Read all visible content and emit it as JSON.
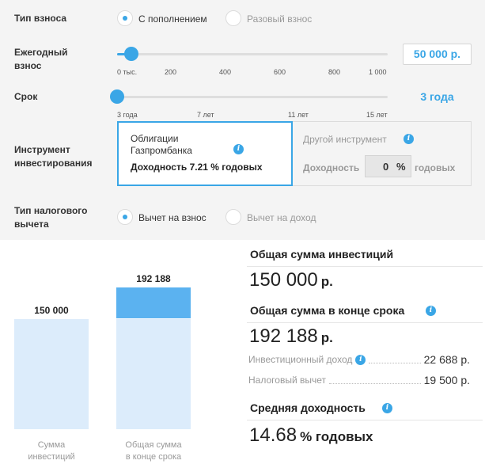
{
  "form": {
    "contribution_type": {
      "label": "Тип взноса",
      "options": [
        "С пополнением",
        "Разовый взнос"
      ],
      "selected": 0
    },
    "annual_contribution": {
      "label_line1": "Ежегодный",
      "label_line2": "взнос",
      "value": "50 000 р.",
      "ticks": [
        "0 тыс.",
        "200",
        "400",
        "600",
        "800",
        "1 000"
      ]
    },
    "term": {
      "label": "Срок",
      "value": "3 года",
      "ticks": [
        "3 года",
        "7 лет",
        "11 лет",
        "15 лет"
      ]
    },
    "instrument": {
      "label_line1": "Инструмент",
      "label_line2": "инвестирования",
      "selected_card": {
        "name_line1": "Облигации",
        "name_line2": "Газпромбанка",
        "yield_text": "Доходность 7.21 % годовых"
      },
      "other_card": {
        "name": "Другой инструмент",
        "yield_label": "Доходность",
        "yield_value": "0",
        "percent": "%",
        "suffix": "годовых"
      }
    },
    "tax_deduction": {
      "label_line1": "Тип налогового",
      "label_line2": "вычета",
      "options": [
        "Вычет на взнос",
        "Вычет на доход"
      ],
      "selected": 0
    }
  },
  "chart_data": {
    "type": "bar",
    "categories": [
      "Сумма инвестиций",
      "Общая сумма в конце срока"
    ],
    "values": [
      150000,
      192188
    ],
    "data_labels": [
      "150 000",
      "192 188"
    ],
    "captions": [
      [
        "Сумма",
        "инвестиций"
      ],
      [
        "Общая сумма",
        "в конце срока"
      ]
    ],
    "stacked_segments": [
      {
        "base": 150000,
        "extra": 0
      },
      {
        "base": 150000,
        "extra": 42188
      }
    ],
    "colors": {
      "base": "#dcecfb",
      "extra": "#5bb2f0"
    }
  },
  "summary": {
    "total_investment_title": "Общая сумма инвестиций",
    "total_investment_value": "150 000",
    "total_end_title": "Общая сумма в конце срока",
    "total_end_value": "192 188",
    "currency": "р.",
    "investment_income_label": "Инвестиционный доход",
    "investment_income_value": "22 688 р.",
    "tax_deduction_label": "Налоговый вычет",
    "tax_deduction_value": "19 500 р.",
    "avg_yield_title": "Средняя доходность",
    "avg_yield_value": "14.68",
    "avg_yield_unit": "% годовых"
  },
  "info_icon": "i",
  "colors": {
    "accent": "#3aa6e6",
    "panel_bg": "#f4f4f4"
  }
}
